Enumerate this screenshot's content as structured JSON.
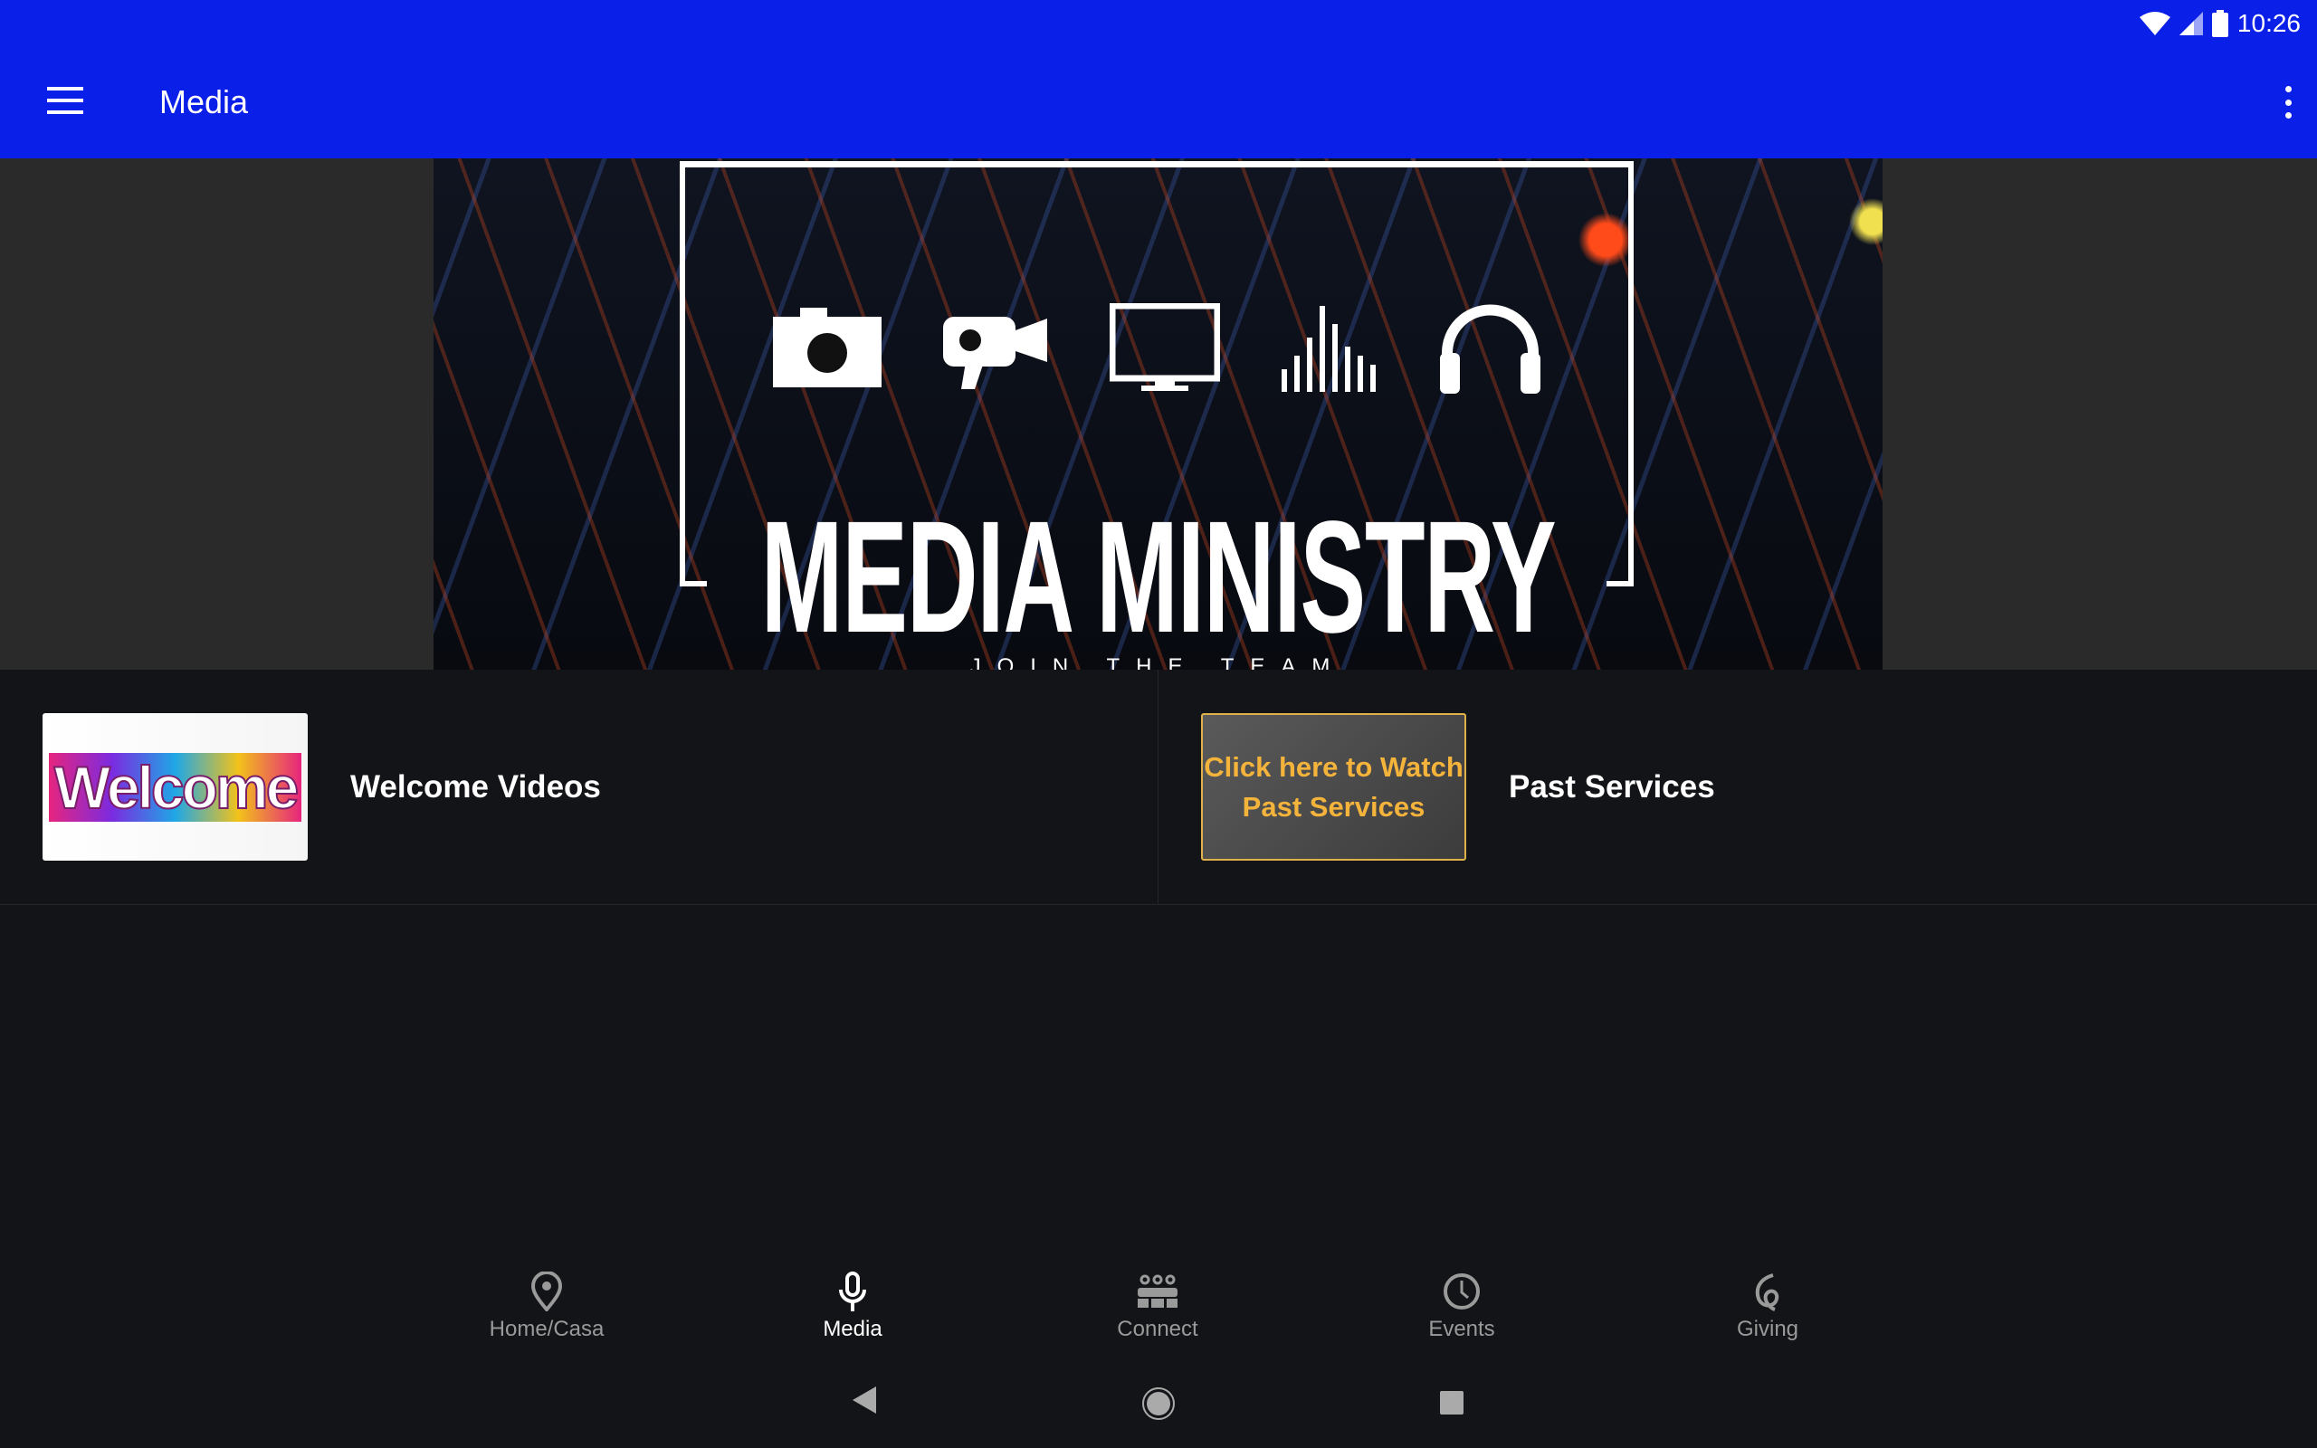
{
  "status_bar": {
    "time": "10:26",
    "icons": [
      "wifi-icon",
      "signal-icon",
      "battery-icon"
    ]
  },
  "app_bar": {
    "title": "Media",
    "menu_icon": "hamburger-icon",
    "overflow_icon": "more-vert-icon",
    "color": "#0a1fe8"
  },
  "banner": {
    "title": "MEDIA MINISTRY",
    "subtitle": "JOIN THE TEAM",
    "icons": [
      "camera-icon",
      "video-camera-icon",
      "monitor-icon",
      "equalizer-icon",
      "headphones-icon"
    ]
  },
  "items": [
    {
      "label": "Welcome Videos",
      "thumbnail_text": "Welcome"
    },
    {
      "label": "Past Services",
      "thumbnail_text": "Click here to Watch Past Services"
    }
  ],
  "bottom_nav": [
    {
      "label": "Home/Casa",
      "icon": "location-pin-icon"
    },
    {
      "label": "Media",
      "icon": "microphone-icon",
      "active": true
    },
    {
      "label": "Connect",
      "icon": "group-icon"
    },
    {
      "label": "Events",
      "icon": "clock-icon"
    },
    {
      "label": "Giving",
      "icon": "giving-icon"
    }
  ],
  "system_nav": [
    "back",
    "home",
    "recents"
  ]
}
